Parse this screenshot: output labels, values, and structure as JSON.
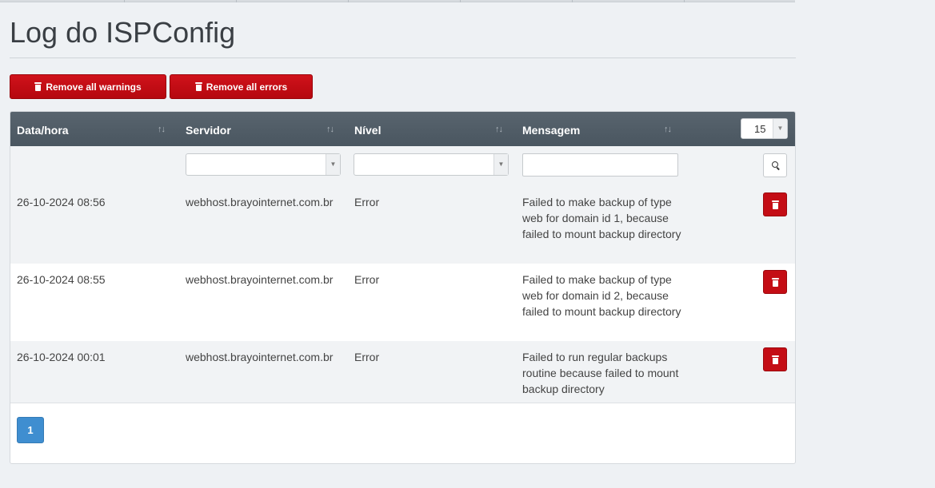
{
  "page": {
    "title": "Log do ISPConfig"
  },
  "actions": {
    "remove_warnings_label": "Remove all warnings",
    "remove_errors_label": "Remove all errors"
  },
  "table": {
    "columns": [
      "Data/hora",
      "Servidor",
      "Nível",
      "Mensagem"
    ],
    "per_page": "15",
    "filters": {
      "servidor": "",
      "nivel": "",
      "mensagem": ""
    },
    "rows": [
      {
        "datetime": "26-10-2024 08:56",
        "server": "webhost.brayointernet.com.br",
        "level": "Error",
        "message": "Failed to make backup of type web for domain id 1, because failed to mount backup directory"
      },
      {
        "datetime": "26-10-2024 08:55",
        "server": "webhost.brayointernet.com.br",
        "level": "Error",
        "message": "Failed to make backup of type web for domain id 2, because failed to mount backup directory"
      },
      {
        "datetime": "26-10-2024 00:01",
        "server": "webhost.brayointernet.com.br",
        "level": "Error",
        "message": "Failed to run regular backups routine because failed to mount backup directory"
      }
    ]
  },
  "pagination": {
    "current_page": "1"
  },
  "icons": {
    "trash": "trash-icon",
    "search": "search-icon",
    "sort": "sort-icon",
    "dropdown": "chevron-down-icon"
  },
  "colors": {
    "danger": "#c40d15",
    "primary": "#3f8ed0",
    "header": "#4e5a64"
  }
}
